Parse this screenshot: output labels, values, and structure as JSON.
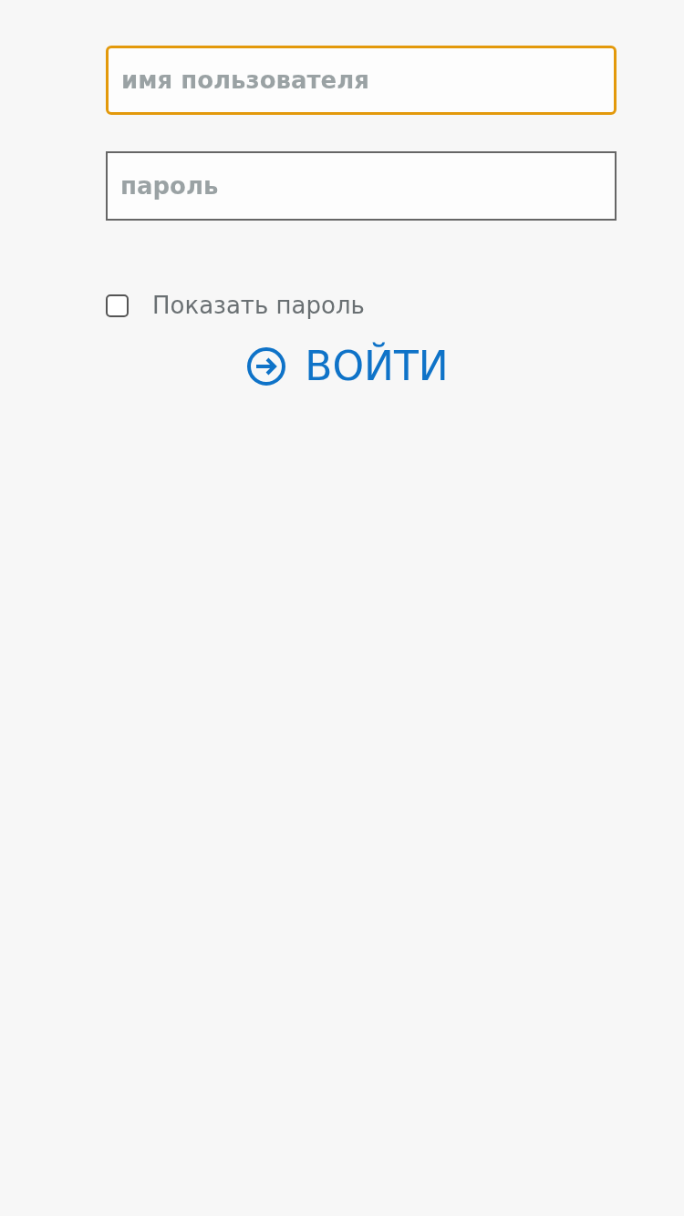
{
  "fields": [
    {
      "placeholder": "имя пользователя",
      "focused": true
    },
    {
      "placeholder": "пароль",
      "focused": false
    }
  ],
  "show_password": {
    "label": "Показать пароль",
    "checked": false
  },
  "login_button": {
    "label": "ВОЙТИ"
  }
}
